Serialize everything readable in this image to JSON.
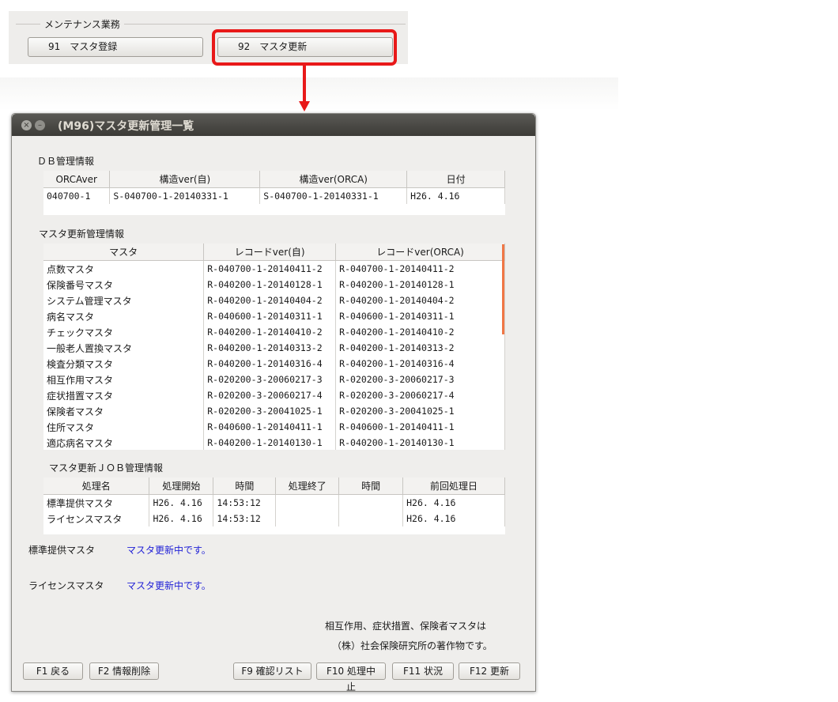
{
  "top_panel": {
    "title": "メンテナンス業務",
    "buttons": [
      {
        "label": "91　マスタ登録"
      },
      {
        "label": "92　マスタ更新"
      }
    ]
  },
  "window": {
    "title": "(M96)マスタ更新管理一覧",
    "db_section": {
      "label": "ＤＢ管理情報",
      "headers": [
        "ORCAver",
        "構造ver(自)",
        "構造ver(ORCA)",
        "日付"
      ],
      "row": [
        "040700-1",
        "S-040700-1-20140331-1",
        "S-040700-1-20140331-1",
        "H26. 4.16"
      ]
    },
    "master_section": {
      "label": "マスタ更新管理情報",
      "headers": [
        "マスタ",
        "レコードver(自)",
        "レコードver(ORCA)"
      ],
      "rows": [
        [
          "点数マスタ",
          "R-040700-1-20140411-2",
          "R-040700-1-20140411-2"
        ],
        [
          "保険番号マスタ",
          "R-040200-1-20140128-1",
          "R-040200-1-20140128-1"
        ],
        [
          "システム管理マスタ",
          "R-040200-1-20140404-2",
          "R-040200-1-20140404-2"
        ],
        [
          "病名マスタ",
          "R-040600-1-20140311-1",
          "R-040600-1-20140311-1"
        ],
        [
          "チェックマスタ",
          "R-040200-1-20140410-2",
          "R-040200-1-20140410-2"
        ],
        [
          "一般老人置換マスタ",
          "R-040200-1-20140313-2",
          "R-040200-1-20140313-2"
        ],
        [
          "検査分類マスタ",
          "R-040200-1-20140316-4",
          "R-040200-1-20140316-4"
        ],
        [
          "相互作用マスタ",
          "R-020200-3-20060217-3",
          "R-020200-3-20060217-3"
        ],
        [
          "症状措置マスタ",
          "R-020200-3-20060217-4",
          "R-020200-3-20060217-4"
        ],
        [
          "保険者マスタ",
          "R-020200-3-20041025-1",
          "R-020200-3-20041025-1"
        ],
        [
          "住所マスタ",
          "R-040600-1-20140411-1",
          "R-040600-1-20140411-1"
        ],
        [
          "適応病名マスタ",
          "R-040200-1-20140130-1",
          "R-040200-1-20140130-1"
        ]
      ]
    },
    "job_section": {
      "label": "マスタ更新ＪＯＢ管理情報",
      "headers": [
        "処理名",
        "処理開始",
        "時間",
        "処理終了",
        "時間",
        "前回処理日"
      ],
      "rows": [
        [
          "標準提供マスタ",
          "H26. 4.16",
          "14:53:12",
          "",
          "",
          "H26. 4.16"
        ],
        [
          "ライセンスマスタ",
          "H26. 4.16",
          "14:53:12",
          "",
          "",
          "H26. 4.16"
        ]
      ]
    },
    "status": [
      {
        "label": "標準提供マスタ",
        "message": "マスタ更新中です。"
      },
      {
        "label": "ライセンスマスタ",
        "message": "マスタ更新中です。"
      }
    ],
    "copyright": [
      "相互作用、症状措置、保険者マスタは",
      "（株）社会保険研究所の著作物です。"
    ],
    "function_keys": [
      {
        "label": "F1 戻る"
      },
      {
        "label": "F2 情報削除"
      },
      {
        "label": "F9 確認リスト"
      },
      {
        "label": "F10 処理中止"
      },
      {
        "label": "F11 状況"
      },
      {
        "label": "F12 更新"
      }
    ],
    "colors": {
      "status_message": "#1f1fd6",
      "highlight": "#e81919",
      "titlebar": "#3c3b37"
    }
  }
}
